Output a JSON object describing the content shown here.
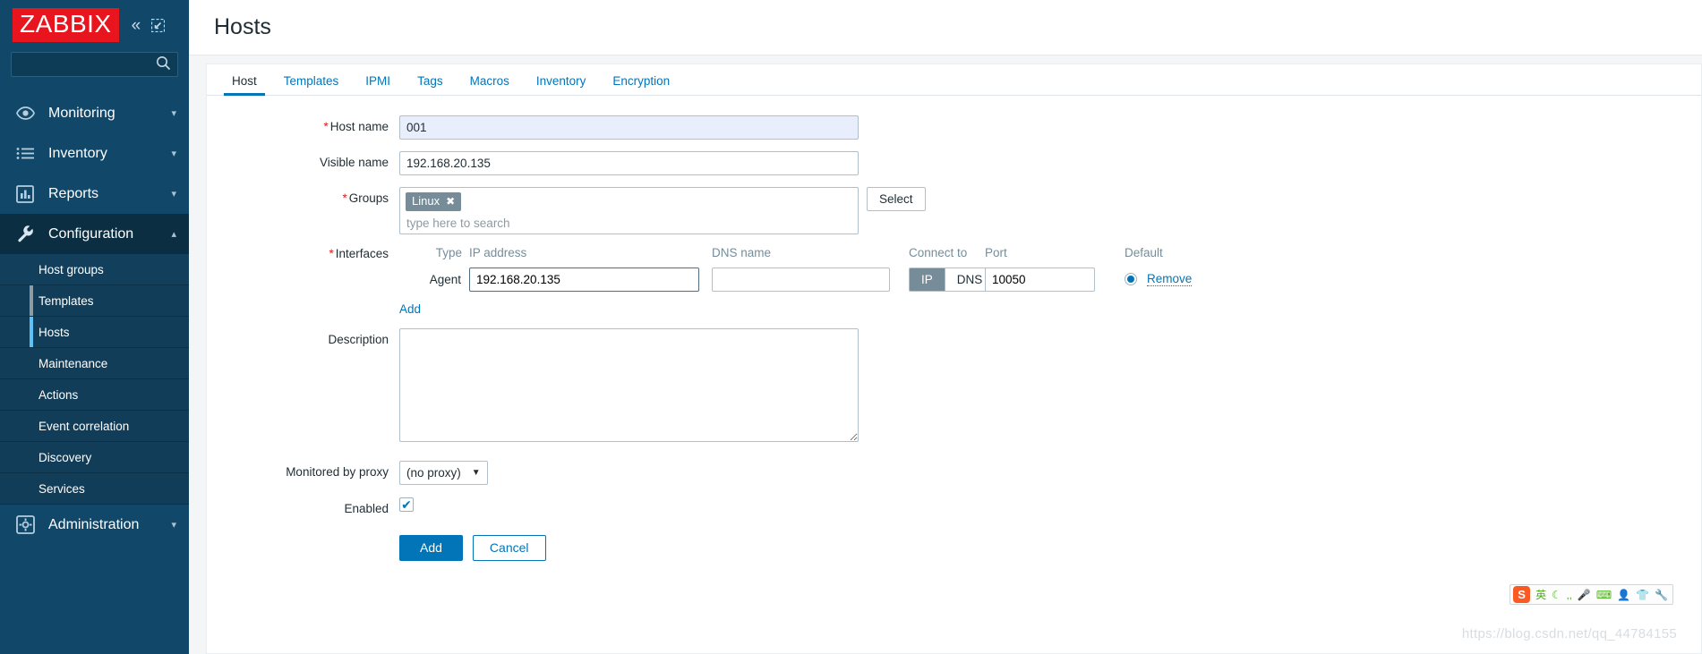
{
  "brand": {
    "logo_text": "ZABBIX"
  },
  "sidebar": {
    "collapse_icon": "chevrons-left-icon",
    "hide_icon": "collapse-panel-icon",
    "search": {
      "value": "",
      "placeholder": ""
    },
    "items": [
      {
        "label": "Monitoring",
        "icon": "eye-icon",
        "chevron": "⌄"
      },
      {
        "label": "Inventory",
        "icon": "list-icon",
        "chevron": "⌄"
      },
      {
        "label": "Reports",
        "icon": "bar-chart-icon",
        "chevron": "⌄"
      },
      {
        "label": "Configuration",
        "icon": "wrench-icon",
        "chevron": "⌃"
      },
      {
        "label": "Administration",
        "icon": "gear-icon",
        "chevron": "⌄"
      }
    ],
    "submenu": [
      {
        "label": "Host groups",
        "state": "normal"
      },
      {
        "label": "Templates",
        "state": "hovered"
      },
      {
        "label": "Hosts",
        "state": "selected"
      },
      {
        "label": "Maintenance",
        "state": "normal"
      },
      {
        "label": "Actions",
        "state": "normal"
      },
      {
        "label": "Event correlation",
        "state": "normal"
      },
      {
        "label": "Discovery",
        "state": "normal"
      },
      {
        "label": "Services",
        "state": "normal"
      }
    ]
  },
  "header": {
    "title": "Hosts"
  },
  "tabs": [
    {
      "label": "Host",
      "active": true
    },
    {
      "label": "Templates",
      "active": false
    },
    {
      "label": "IPMI",
      "active": false
    },
    {
      "label": "Tags",
      "active": false
    },
    {
      "label": "Macros",
      "active": false
    },
    {
      "label": "Inventory",
      "active": false
    },
    {
      "label": "Encryption",
      "active": false
    }
  ],
  "form": {
    "host_name": {
      "label": "Host name",
      "required": true,
      "value": "001"
    },
    "visible_name": {
      "label": "Visible name",
      "required": false,
      "value": "192.168.20.135"
    },
    "groups": {
      "label": "Groups",
      "required": true,
      "chips": [
        "Linux"
      ],
      "chip_remove_glyph": "✖",
      "placeholder": "type here to search",
      "select_button": "Select"
    },
    "interfaces": {
      "label": "Interfaces",
      "required": true,
      "columns": [
        "Type",
        "IP address",
        "DNS name",
        "Connect to",
        "Port",
        "Default"
      ],
      "rows": [
        {
          "type": "Agent",
          "ip": "192.168.20.135",
          "dns": "",
          "connect_to": {
            "options": [
              "IP",
              "DNS"
            ],
            "selected": "IP"
          },
          "port": "10050",
          "default_selected": true,
          "remove_label": "Remove"
        }
      ],
      "add_label": "Add"
    },
    "description": {
      "label": "Description",
      "value": "",
      "placeholder": ""
    },
    "monitored_by_proxy": {
      "label": "Monitored by proxy",
      "selected": "(no proxy)",
      "options": [
        "(no proxy)"
      ],
      "caret": "▼"
    },
    "enabled": {
      "label": "Enabled",
      "checked": true,
      "tick": "✔"
    },
    "actions": {
      "submit": "Add",
      "cancel": "Cancel"
    }
  },
  "ime": {
    "logo": "S",
    "mode": "英",
    "icons": [
      "moon-icon",
      "comma-icon",
      "microphone-icon",
      "keyboard-icon",
      "user-icon",
      "shirt-icon",
      "wrench-icon"
    ]
  },
  "watermark": "https://blog.csdn.net/qq_44784155",
  "colors": {
    "sidebar_bg": "#11486a",
    "brand_red": "#e8141e",
    "link_blue": "#0275b8",
    "required_red": "#d31f1f",
    "chip_grey": "#768d99"
  }
}
